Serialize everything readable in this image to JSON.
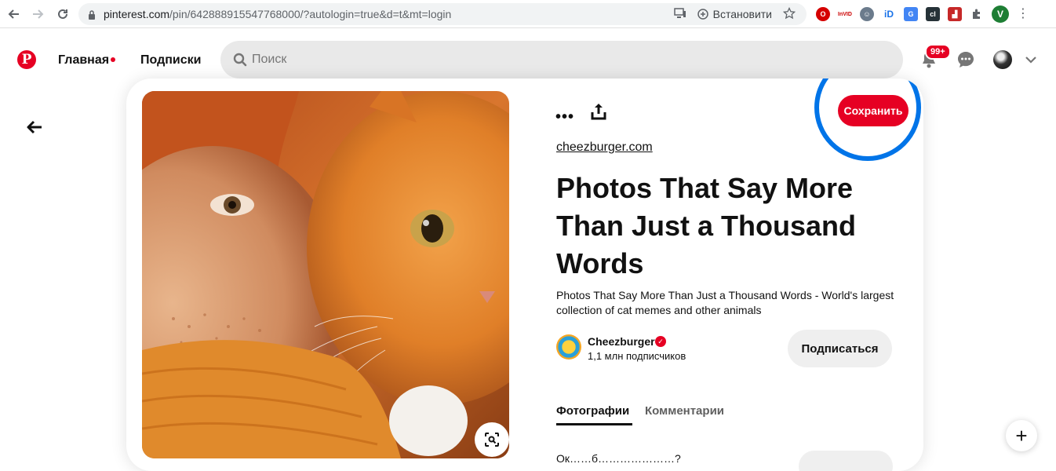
{
  "browser": {
    "url_host": "pinterest.com",
    "url_path": "/pin/642888915547768000/?autologin=true&d=t&mt=login",
    "install_label": "Встановити",
    "profile_initial": "V"
  },
  "header": {
    "logo": "P",
    "nav_home": "Главная",
    "nav_subscriptions": "Подписки",
    "search_placeholder": "Поиск",
    "notifications_badge": "99+"
  },
  "pin": {
    "source": "cheezburger.com",
    "save_label": "Сохранить",
    "title": "Photos That Say More Than Just a Thousand Words",
    "description": "Photos That Say More Than Just a Thousand Words - World's largest collection of cat memes and other animals",
    "creator_name": "Cheezburger",
    "creator_followers": "1,1 млн подписчиков",
    "follow_label": "Подписаться",
    "tabs": [
      "Фотографии",
      "Комментарии"
    ],
    "bottom_text": "Ок……б…………………?"
  },
  "colors": {
    "brand_red": "#e60023",
    "highlight_blue": "#0074e8"
  }
}
